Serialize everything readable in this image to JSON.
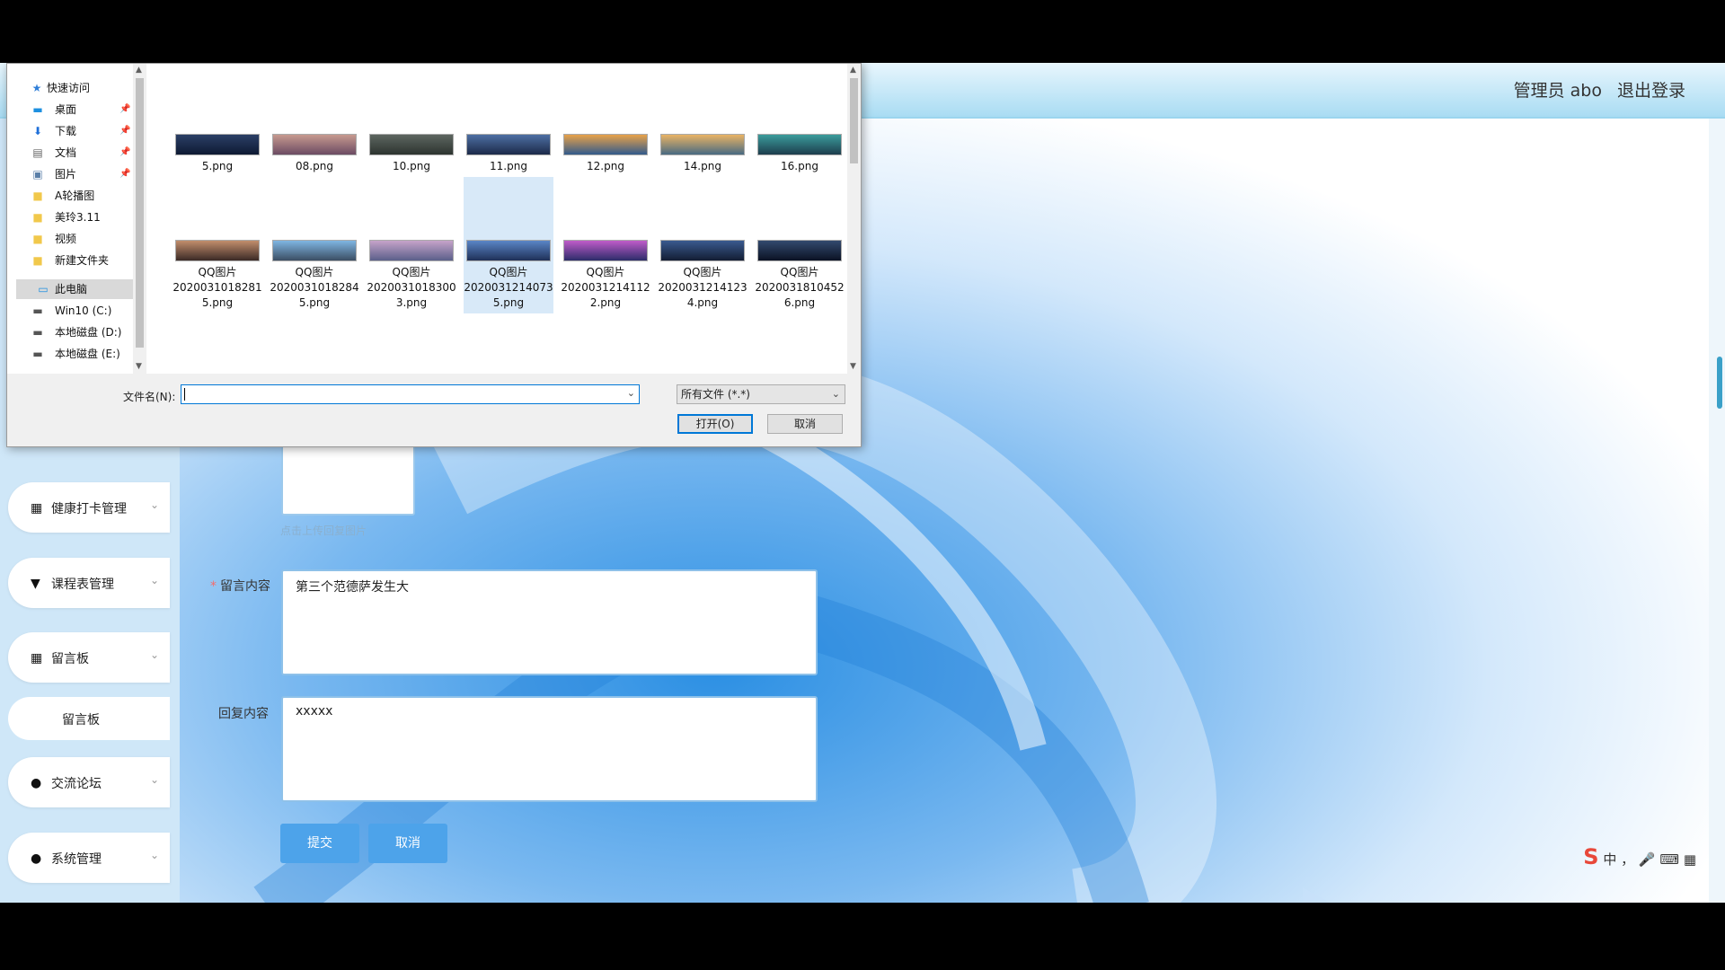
{
  "header": {
    "user": "管理员 abo",
    "logout": "退出登录"
  },
  "sidebar": {
    "items": [
      {
        "label": "健康打卡管理",
        "icon": "grid-icon"
      },
      {
        "label": "课程表管理",
        "icon": "pin-icon"
      },
      {
        "label": "留言板",
        "icon": "grid-icon"
      },
      {
        "label": "交流论坛",
        "icon": "user-icon"
      },
      {
        "label": "系统管理",
        "icon": "user-icon"
      }
    ],
    "sub_item": "留言板"
  },
  "form": {
    "upload_hint": "点击上传回复图片",
    "message_label": "留言内容",
    "message_value": "第三个范德萨发生大",
    "reply_label": "回复内容",
    "reply_value": "xxxxx",
    "submit": "提交",
    "cancel": "取消"
  },
  "dialog": {
    "nav": {
      "quick_access": "快速访问",
      "desktop": "桌面",
      "downloads": "下载",
      "documents": "文档",
      "pictures": "图片",
      "folder_a": "A轮播图",
      "folder_meiling": "美玲3.11",
      "folder_video": "视频",
      "folder_new": "新建文件夹",
      "this_pc": "此电脑",
      "drive_c": "Win10 (C:)",
      "drive_d": "本地磁盘 (D:)",
      "drive_e": "本地磁盘 (E:)"
    },
    "files_row1": [
      "5.png",
      "08.png",
      "10.png",
      "11.png",
      "12.png",
      "14.png",
      "16.png"
    ],
    "files_row2": [
      {
        "l1": "QQ图片",
        "l2": "2020031018281",
        "l3": "5.png"
      },
      {
        "l1": "QQ图片",
        "l2": "2020031018284",
        "l3": "5.png"
      },
      {
        "l1": "QQ图片",
        "l2": "2020031018300",
        "l3": "3.png"
      },
      {
        "l1": "QQ图片",
        "l2": "2020031214073",
        "l3": "5.png"
      },
      {
        "l1": "QQ图片",
        "l2": "2020031214112",
        "l3": "2.png"
      },
      {
        "l1": "QQ图片",
        "l2": "2020031214123",
        "l3": "4.png"
      },
      {
        "l1": "QQ图片",
        "l2": "2020031810452",
        "l3": "6.png"
      }
    ],
    "filename_label": "文件名(N):",
    "filename_value": "",
    "filetype": "所有文件 (*.*)",
    "open_button": "打开(O)",
    "cancel_button": "取消"
  },
  "colors": {
    "accent": "#4da3ea",
    "header": "#a9dcf3",
    "sidebar": "#cfe7f8"
  }
}
